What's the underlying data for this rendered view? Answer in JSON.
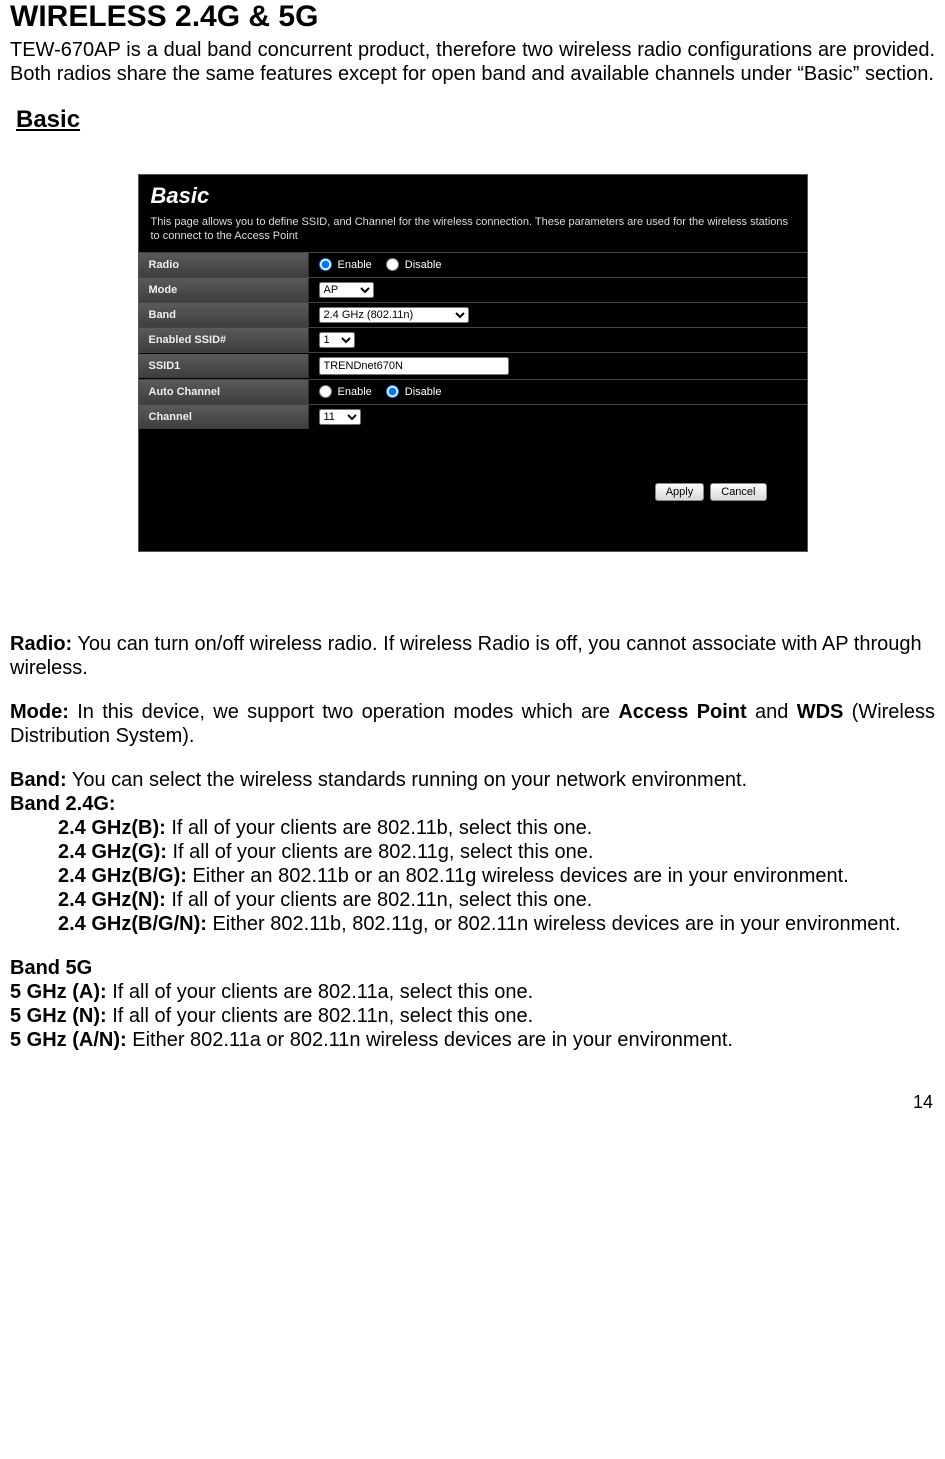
{
  "main_title": "WIRELESS 2.4G & 5G",
  "intro": "TEW-670AP is a dual band concurrent product, therefore two wireless radio configurations are provided. Both radios share the same features except for open band and available channels under “Basic” section.",
  "basic_heading": "Basic",
  "screenshot": {
    "title": "Basic",
    "desc": "This page allows you to define SSID, and Channel for the wireless connection. These parameters are used for the wireless stations to connect to the Access Point",
    "rows": {
      "radio": {
        "label": "Radio",
        "enable": "Enable",
        "disable": "Disable",
        "selected": "enable"
      },
      "mode": {
        "label": "Mode",
        "value": "AP"
      },
      "band": {
        "label": "Band",
        "value": "2.4 GHz (802.11n)"
      },
      "enabled_ssid": {
        "label": "Enabled SSID#",
        "value": "1"
      },
      "ssid1": {
        "label": "SSID1",
        "value": "TRENDnet670N"
      },
      "auto_channel": {
        "label": "Auto Channel",
        "enable": "Enable",
        "disable": "Disable",
        "selected": "disable"
      },
      "channel": {
        "label": "Channel",
        "value": "11"
      }
    },
    "buttons": {
      "apply": "Apply",
      "cancel": "Cancel"
    }
  },
  "desc": {
    "radio_label": "Radio:",
    "radio_text": " You can turn on/off wireless radio. If wireless Radio is off, you cannot associate with AP through wireless.",
    "mode_label": "Mode:",
    "mode_text1": " In this device, we support two operation modes which are ",
    "mode_bold1": "Access Point",
    "mode_text2": " and ",
    "mode_bold2": "WDS",
    "mode_text3": " (Wireless Distribution System).",
    "band_label": "Band:",
    "band_text": " You can select the wireless standards running on your network environment.",
    "band24_heading": "Band 2.4G:",
    "band24b_label": "2.4 GHz(B):",
    "band24b_text": " If all of your clients are 802.11b, select this one.",
    "band24g_label": "2.4 GHz(G):",
    "band24g_text": " If all of your clients are 802.11g, select this one.",
    "band24bg_label": "2.4 GHz(B/G):",
    "band24bg_text": " Either an 802.11b or an 802.11g wireless devices are in your environment.",
    "band24n_label": "2.4 GHz(N):",
    "band24n_text": " If all of your clients are 802.11n, select this one.",
    "band24bgn_label": "2.4 GHz(B/G/N):",
    "band24bgn_text": " Either 802.11b, 802.11g, or 802.11n wireless devices are in your environment.",
    "band5_heading": "Band 5G",
    "band5a_label": "5 GHz (A):",
    "band5a_text": " If all of your clients are 802.11a, select this one.",
    "band5n_label": "5 GHz (N):",
    "band5n_text": " If all of your clients are 802.11n, select this one.",
    "band5an_label": "5 GHz (A/N):",
    "band5an_text": " Either 802.11a or 802.11n wireless devices are in your environment."
  },
  "page_num": "14"
}
